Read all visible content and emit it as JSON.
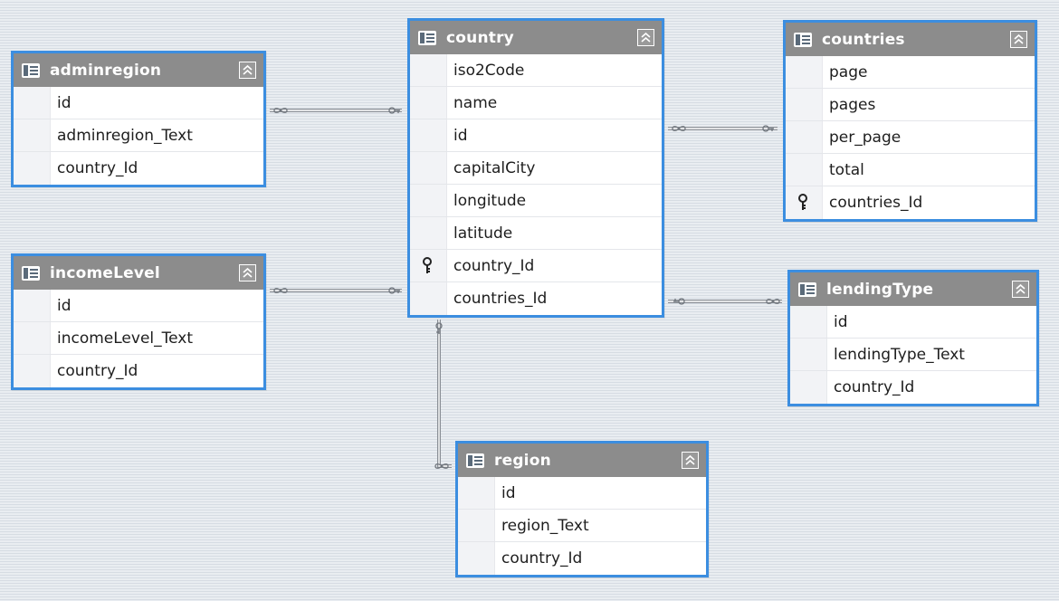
{
  "diagram": {
    "tables": [
      {
        "id": "adminregion",
        "title": "adminregion",
        "columns": [
          {
            "name": "id",
            "key": false
          },
          {
            "name": "adminregion_Text",
            "key": false
          },
          {
            "name": "country_Id",
            "key": false
          }
        ]
      },
      {
        "id": "incomeLevel",
        "title": "incomeLevel",
        "columns": [
          {
            "name": "id",
            "key": false
          },
          {
            "name": "incomeLevel_Text",
            "key": false
          },
          {
            "name": "country_Id",
            "key": false
          }
        ]
      },
      {
        "id": "country",
        "title": "country",
        "columns": [
          {
            "name": "iso2Code",
            "key": false
          },
          {
            "name": "name",
            "key": false
          },
          {
            "name": "id",
            "key": false
          },
          {
            "name": "capitalCity",
            "key": false
          },
          {
            "name": "longitude",
            "key": false
          },
          {
            "name": "latitude",
            "key": false
          },
          {
            "name": "country_Id",
            "key": true
          },
          {
            "name": "countries_Id",
            "key": false
          }
        ]
      },
      {
        "id": "countries",
        "title": "countries",
        "columns": [
          {
            "name": "page",
            "key": false
          },
          {
            "name": "pages",
            "key": false
          },
          {
            "name": "per_page",
            "key": false
          },
          {
            "name": "total",
            "key": false
          },
          {
            "name": "countries_Id",
            "key": true
          }
        ]
      },
      {
        "id": "lendingType",
        "title": "lendingType",
        "columns": [
          {
            "name": "id",
            "key": false
          },
          {
            "name": "lendingType_Text",
            "key": false
          },
          {
            "name": "country_Id",
            "key": false
          }
        ]
      },
      {
        "id": "region",
        "title": "region",
        "columns": [
          {
            "name": "id",
            "key": false
          },
          {
            "name": "region_Text",
            "key": false
          },
          {
            "name": "country_Id",
            "key": false
          }
        ]
      }
    ],
    "relations": [
      {
        "from": "adminregion",
        "to": "country",
        "many_end": "adminregion",
        "one_end": "country"
      },
      {
        "from": "incomeLevel",
        "to": "country",
        "many_end": "incomeLevel",
        "one_end": "country"
      },
      {
        "from": "countries",
        "to": "country",
        "many_end": "country",
        "one_end": "countries"
      },
      {
        "from": "lendingType",
        "to": "country",
        "many_end": "lendingType",
        "one_end": "country"
      },
      {
        "from": "region",
        "to": "country",
        "many_end": "region",
        "one_end": "country"
      }
    ]
  },
  "icons": {
    "table": "table-icon",
    "collapse": "collapse-chevrons-icon",
    "primary_key": "key-icon",
    "relation_one": "key-connector-icon",
    "relation_many": "infinity-connector-icon"
  },
  "colors": {
    "selection_border": "#3c8ee0",
    "header_background": "#8c8c8c",
    "header_text": "#ffffff",
    "canvas_background": "#e5e9ee",
    "connector": "#8a8f96"
  }
}
